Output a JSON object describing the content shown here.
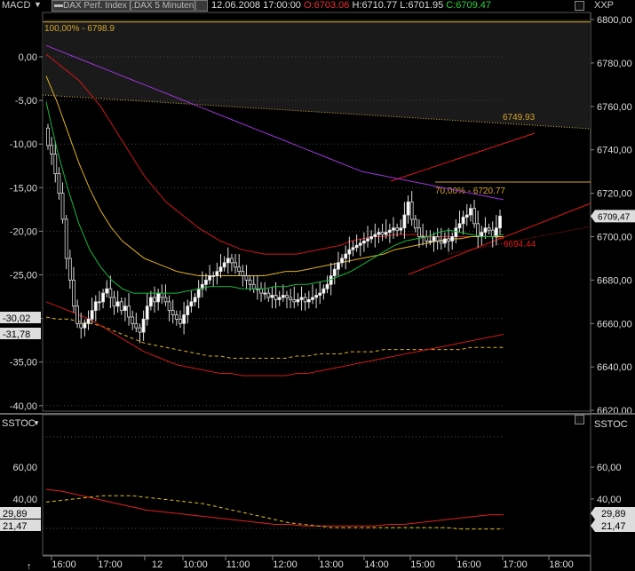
{
  "header": {
    "left_indicator": "MACD",
    "instrument": "DAX Perf. Index [.DAX 5 Minuten]",
    "datetime": "12.06.2008 17:00:00",
    "open": "O:6703.06",
    "high": "H:6710.77",
    "low": "L:6701.95",
    "close": "C:6709.47",
    "right_label": "XXP"
  },
  "lower_panel": {
    "left_label": "SSTOC",
    "right_label": "SSTOC"
  },
  "annotations": {
    "fib_100": "100,00% - 6798.9",
    "level_6749": "6749.93",
    "fib_70": "70,00% - 6720.77",
    "level_6694": "6694.44"
  },
  "price_tag": "6709,47",
  "colors": {
    "up": "#ffffff",
    "down": "#bbbbbb",
    "ma_purple": "#9b35d8",
    "ma_red": "#d01818",
    "ma_orange": "#e0b020",
    "ma_green": "#19b83c",
    "fib": "#d5a530",
    "channel": "#e01818"
  },
  "chart_data": [
    {
      "type": "candlestick",
      "title": "DAX Perf. Index [.DAX 5 Minuten]",
      "y_axis_right": [
        6800,
        6780,
        6760,
        6740,
        6720,
        6700,
        6680,
        6660,
        6640,
        6620
      ],
      "y_axis_right_labels": [
        "6800,00",
        "6780,00",
        "6760,00",
        "6740,00",
        "6720,00",
        "6700,00",
        "6680,00",
        "6660,00",
        "6640,00",
        "6620,00"
      ],
      "y_axis_left_macd": [
        0,
        -5,
        -10,
        -15,
        -20,
        -25,
        -30,
        -35,
        -40
      ],
      "y_axis_left_labels": [
        "0,00",
        "-5,00",
        "-10,00",
        "-15,00",
        "-20,00",
        "-25,00",
        "-30,00",
        "-35,00",
        "-40,00"
      ],
      "macd_tags": [
        "-30,02",
        "-31,78"
      ],
      "x_labels": [
        "16:00",
        "17:00",
        "12",
        "10:00",
        "11:00",
        "12:00",
        "13:00",
        "14:00",
        "15:00",
        "16:00",
        "17:00",
        "18:00"
      ],
      "ylim": [
        6614,
        6803
      ],
      "closes": [
        6742,
        6738,
        6729,
        6720,
        6708,
        6690,
        6680,
        6668,
        6660,
        6658,
        6660,
        6662,
        6666,
        6670,
        6670,
        6674,
        6676,
        6672,
        6668,
        6670,
        6666,
        6668,
        6663,
        6660,
        6658,
        6656,
        6662,
        6668,
        6672,
        6670,
        6674,
        6672,
        6670,
        6666,
        6664,
        6662,
        6660,
        6664,
        6668,
        6670,
        6672,
        6676,
        6678,
        6680,
        6682,
        6682,
        6684,
        6686,
        6688,
        6690,
        6688,
        6686,
        6684,
        6682,
        6680,
        6678,
        6676,
        6676,
        6674,
        6674,
        6672,
        6673,
        6671,
        6672,
        6673,
        6672,
        6671,
        6670,
        6671,
        6672,
        6670,
        6671,
        6672,
        6673,
        6674,
        6676,
        6678,
        6682,
        6685,
        6688,
        6690,
        6692,
        6694,
        6695,
        6696,
        6697,
        6698,
        6699,
        6700,
        6701,
        6702,
        6701,
        6702,
        6703,
        6704,
        6703,
        6704,
        6710,
        6716,
        6708,
        6704,
        6700,
        6700,
        6698,
        6698,
        6700,
        6698,
        6697,
        6699,
        6698,
        6700,
        6704,
        6706,
        6709,
        6710,
        6713,
        6706,
        6700,
        6702,
        6704,
        6703,
        6700,
        6704,
        6709.47
      ],
      "ma_purple": [
        6788,
        6786,
        6784,
        6782,
        6780,
        6778,
        6776,
        6774,
        6772,
        6770,
        6768,
        6766,
        6764,
        6762,
        6760,
        6758,
        6756,
        6754,
        6752,
        6750,
        6748,
        6746,
        6744,
        6742,
        6740,
        6738,
        6736,
        6734,
        6732,
        6730,
        6729,
        6728,
        6727,
        6726,
        6725,
        6724,
        6723,
        6722,
        6721,
        6720,
        6719,
        6718,
        6717
      ],
      "ma_red_upper": [
        6784,
        6780,
        6776,
        6772,
        6766,
        6760,
        6752,
        6744,
        6736,
        6728,
        6722,
        6716,
        6712,
        6708,
        6704,
        6701,
        6698,
        6696,
        6694,
        6693,
        6692,
        6692,
        6692,
        6692,
        6693,
        6694,
        6695,
        6696,
        6698,
        6699,
        6700,
        6700,
        6701,
        6701,
        6701,
        6700,
        6700,
        6700,
        6700,
        6700,
        6700,
        6700,
        6699
      ],
      "ma_orange": [
        6774,
        6762,
        6748,
        6734,
        6722,
        6712,
        6704,
        6698,
        6694,
        6690,
        6688,
        6686,
        6684,
        6683,
        6682,
        6682,
        6682,
        6682,
        6682,
        6682,
        6682,
        6683,
        6684,
        6684,
        6685,
        6686,
        6687,
        6688,
        6689,
        6690,
        6691,
        6692,
        6694,
        6695,
        6696,
        6697,
        6698,
        6699,
        6699,
        6700,
        6700,
        6700,
        6700
      ],
      "ma_green": [
        6762,
        6740,
        6722,
        6706,
        6694,
        6686,
        6680,
        6676,
        6674,
        6674,
        6674,
        6674,
        6674,
        6675,
        6676,
        6677,
        6677,
        6677,
        6676,
        6676,
        6676,
        6677,
        6677,
        6678,
        6678,
        6679,
        6680,
        6682,
        6684,
        6687,
        6690,
        6693,
        6696,
        6698,
        6699,
        6700,
        6702,
        6703,
        6702,
        6701,
        6700,
        6700,
        6701
      ],
      "ma_dash_orange": [
        6663,
        6662,
        6662,
        6661,
        6660,
        6659,
        6657,
        6655,
        6653,
        6651,
        6650,
        6649,
        6648,
        6647,
        6646,
        6645,
        6645,
        6644,
        6644,
        6644,
        6644,
        6644,
        6644,
        6645,
        6645,
        6646,
        6646,
        6646,
        6647,
        6647,
        6647,
        6648,
        6648,
        6648,
        6648,
        6648,
        6648,
        6648,
        6648,
        6649,
        6649,
        6649,
        6649
      ],
      "ma_red_lower": [
        6670,
        6668,
        6666,
        6664,
        6662,
        6659,
        6656,
        6653,
        6650,
        6647,
        6645,
        6643,
        6641,
        6640,
        6639,
        6638,
        6637,
        6637,
        6636,
        6636,
        6636,
        6636,
        6636,
        6637,
        6637,
        6638,
        6639,
        6640,
        6641,
        6642,
        6643,
        6644,
        6645,
        6646,
        6647,
        6648,
        6649,
        6650,
        6651,
        6652,
        6653,
        6654,
        6655
      ]
    },
    {
      "type": "line",
      "title": "SSTOC",
      "y_axis_labels": [
        "60,00",
        "40,00"
      ],
      "y_ticks": [
        60,
        40
      ],
      "tags": [
        "29,89",
        "21,47"
      ],
      "ylim": [
        5,
        80
      ],
      "series": [
        {
          "values": [
            46,
            45,
            43,
            41,
            39,
            37,
            35,
            33,
            32,
            31,
            30,
            29,
            28,
            27,
            26,
            25,
            24,
            24,
            23,
            23,
            23,
            23,
            23,
            23,
            24,
            24,
            25,
            26,
            27,
            28,
            29,
            30,
            30
          ]
        },
        {
          "values": [
            38,
            39,
            40,
            41,
            42,
            42,
            42,
            41,
            40,
            39,
            38,
            37,
            35,
            33,
            31,
            29,
            27,
            25,
            24,
            23,
            22,
            22,
            22,
            22,
            22,
            22,
            22,
            22,
            22,
            21,
            21,
            21,
            21
          ]
        }
      ]
    }
  ]
}
